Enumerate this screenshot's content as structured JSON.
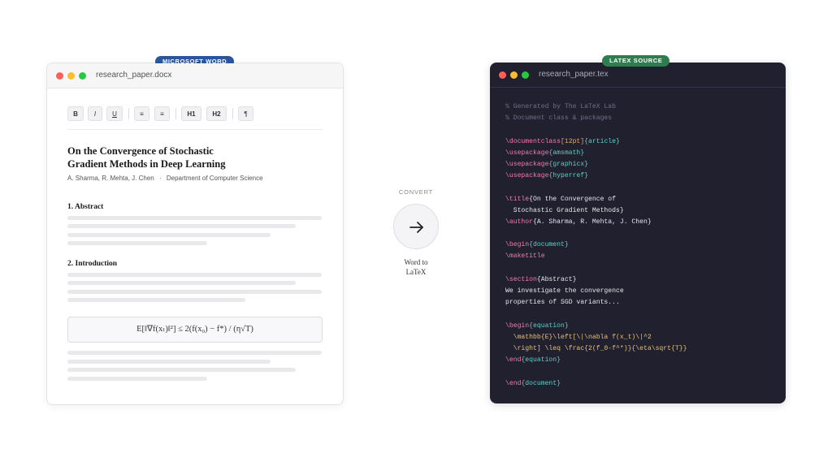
{
  "word": {
    "badge": "MICROSOFT WORD",
    "filename": "research_paper.docx",
    "toolbar": [
      "B",
      "I",
      "U",
      "≡",
      "≡",
      "H1",
      "H2",
      "¶"
    ],
    "title_line1": "On the Convergence of Stochastic",
    "title_line2": "Gradient Methods in Deep Learning",
    "authors": "A. Sharma, R. Mehta, J. Chen",
    "meta_sep": "·",
    "department": "Department of Computer Science",
    "section1": "1. Abstract",
    "section2": "2. Introduction",
    "equation": "E[‖∇f(xₜ)‖²] ≤ 2(f(x₀) − f*) / (η√T)"
  },
  "convert": {
    "label": "CONVERT",
    "caption_line1": "Word to",
    "caption_line2": "LaTeX"
  },
  "latex": {
    "badge": "LATEX SOURCE",
    "filename": "research_paper.tex",
    "lines": [
      [
        {
          "t": "% Generated by The LaTeX Lab",
          "c": "com"
        }
      ],
      [
        {
          "t": "% Document class & packages",
          "c": "com"
        }
      ],
      [],
      [
        {
          "t": "\\documentclass",
          "c": "cmd"
        },
        {
          "t": "[12pt]",
          "c": "opt"
        },
        {
          "t": "{article}",
          "c": "arg"
        }
      ],
      [
        {
          "t": "\\usepackage",
          "c": "cmd"
        },
        {
          "t": "{amsmath}",
          "c": "arg"
        }
      ],
      [
        {
          "t": "\\usepackage",
          "c": "cmd"
        },
        {
          "t": "{graphicx}",
          "c": "arg"
        }
      ],
      [
        {
          "t": "\\usepackage",
          "c": "cmd"
        },
        {
          "t": "{hyperref}",
          "c": "arg"
        }
      ],
      [],
      [
        {
          "t": "\\title",
          "c": "cmd"
        },
        {
          "t": "{On the Convergence of",
          "c": "txt"
        }
      ],
      [
        {
          "t": "  Stochastic Gradient Methods}",
          "c": "txt"
        }
      ],
      [
        {
          "t": "\\author",
          "c": "cmd"
        },
        {
          "t": "{A. Sharma, R. Mehta, J. Chen}",
          "c": "txt"
        }
      ],
      [],
      [
        {
          "t": "\\begin",
          "c": "cmd"
        },
        {
          "t": "{document}",
          "c": "arg"
        }
      ],
      [
        {
          "t": "\\maketitle",
          "c": "cmd"
        }
      ],
      [],
      [
        {
          "t": "\\section",
          "c": "cmd"
        },
        {
          "t": "{Abstract}",
          "c": "txt"
        }
      ],
      [
        {
          "t": "We investigate the convergence",
          "c": "txt"
        }
      ],
      [
        {
          "t": "properties of SGD variants...",
          "c": "txt"
        }
      ],
      [],
      [
        {
          "t": "\\begin",
          "c": "cmd"
        },
        {
          "t": "{equation}",
          "c": "arg"
        }
      ],
      [
        {
          "t": "  \\mathbb{E}\\left[\\|\\nabla f(x_t)\\|^2",
          "c": "math"
        }
      ],
      [
        {
          "t": "  \\right] \\leq \\frac{2(f_0-f^*)}{\\eta\\sqrt{T}}",
          "c": "math"
        }
      ],
      [
        {
          "t": "\\end",
          "c": "cmd"
        },
        {
          "t": "{equation}",
          "c": "arg"
        }
      ],
      [],
      [
        {
          "t": "\\end",
          "c": "cmd"
        },
        {
          "t": "{document}",
          "c": "arg"
        }
      ]
    ]
  },
  "colors": {
    "word_badge": "#2b579a",
    "latex_badge": "#2e7d4f",
    "editor_bg": "#21202e",
    "syntax_command": "#f37cae",
    "syntax_argument": "#5fd0c8",
    "syntax_option": "#f0a95a",
    "syntax_comment": "#6d7089"
  }
}
